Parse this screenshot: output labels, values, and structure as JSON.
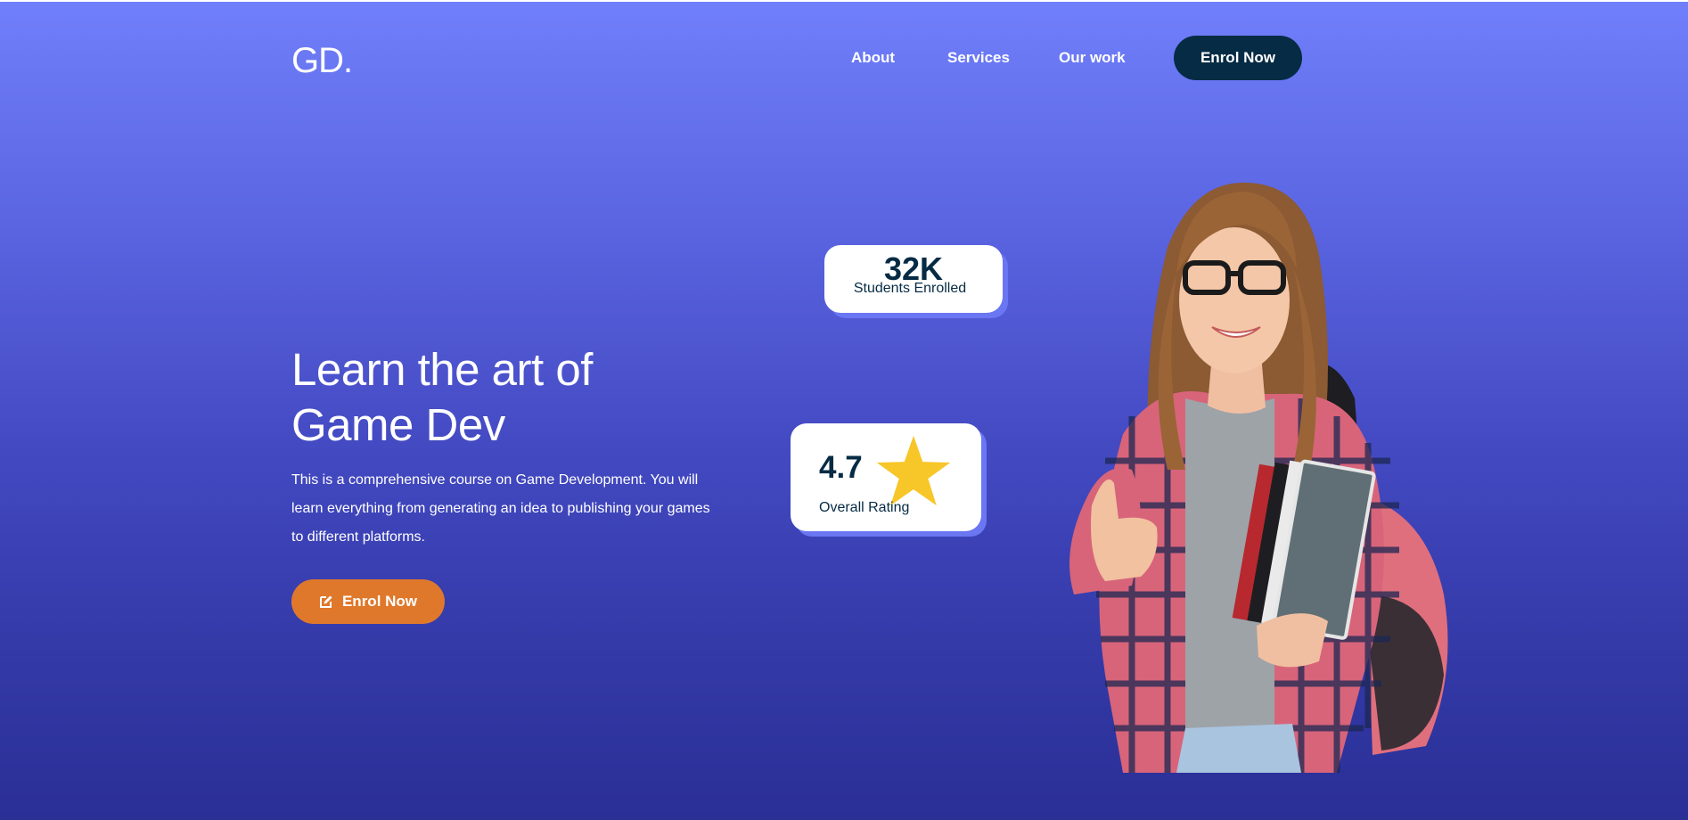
{
  "header": {
    "logo": "GD.",
    "nav": [
      {
        "label": "About"
      },
      {
        "label": "Services"
      },
      {
        "label": "Our work"
      }
    ],
    "enrol_label": "Enrol Now"
  },
  "hero": {
    "title_line1": "Learn the art of",
    "title_line2": "Game Dev",
    "description": "This is a comprehensive course on Game Development. You will learn everything from generating an idea to publishing your games to different platforms.",
    "cta_label": "Enrol Now",
    "cta_icon": "edit-icon"
  },
  "stats": {
    "students": {
      "value": "32K",
      "label": "Students Enrolled"
    },
    "rating": {
      "value": "4.7",
      "label": "Overall Rating",
      "icon": "star-icon"
    }
  },
  "colors": {
    "background_top": "#707ffb",
    "background_bottom": "#2a2f96",
    "primary_dark": "#062b44",
    "accent_orange": "#e0782b",
    "star": "#f7c628",
    "card_shadow": "#6a76f2"
  }
}
